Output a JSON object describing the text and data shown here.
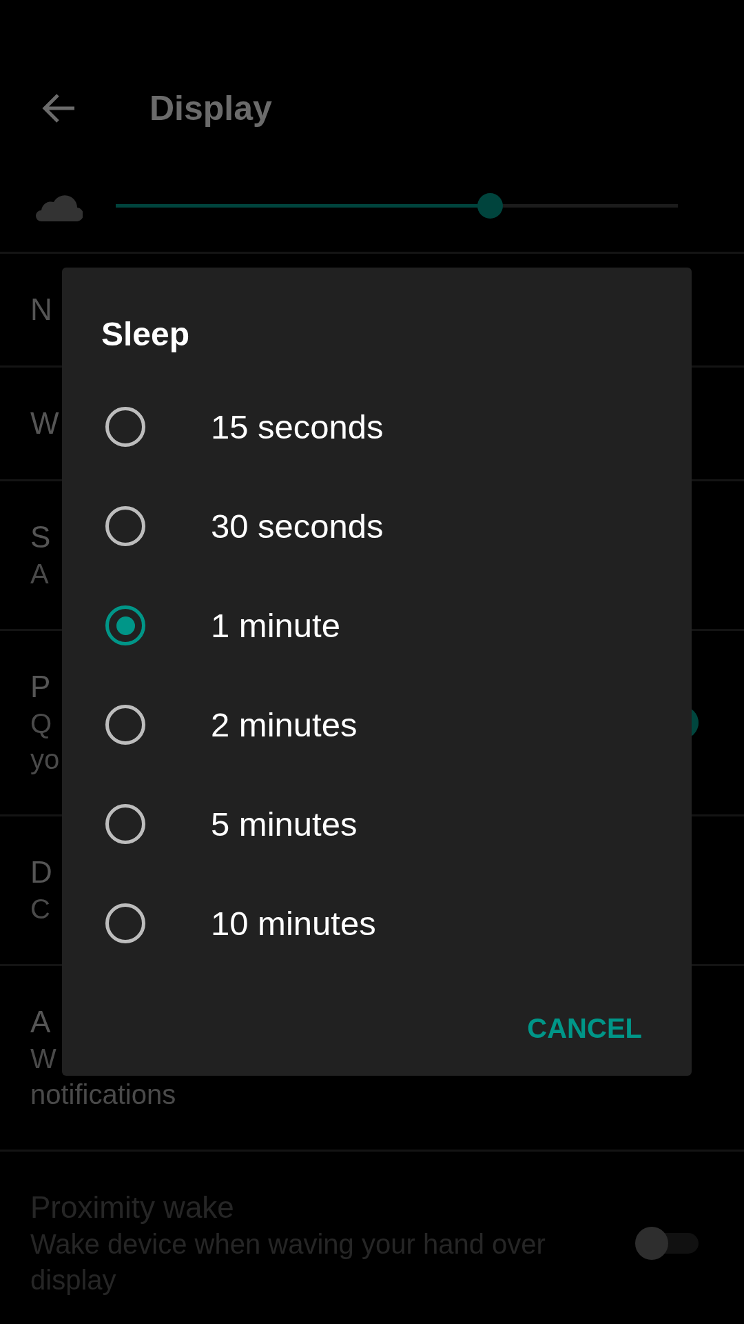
{
  "header": {
    "title": "Display"
  },
  "brightness": {
    "level": 0.665
  },
  "settings": [
    {
      "kind": "text",
      "title": "N"
    },
    {
      "kind": "text",
      "title": "W"
    },
    {
      "kind": "text",
      "title": "S",
      "summary": [
        "A"
      ]
    },
    {
      "kind": "switch",
      "title": "P",
      "summary": [
        "Q",
        "yo"
      ],
      "on": true,
      "disabled": false
    },
    {
      "kind": "text",
      "title": "D",
      "summary": [
        "C"
      ]
    },
    {
      "kind": "text",
      "title": "A",
      "summary": [
        "W",
        "notifications"
      ]
    },
    {
      "kind": "switch",
      "title": "Proximity wake",
      "summary": [
        "Wake device when waving your hand over",
        "display"
      ],
      "on": false,
      "disabled": true
    }
  ],
  "dialog": {
    "title": "Sleep",
    "options": [
      {
        "label": "15 seconds",
        "selected": false
      },
      {
        "label": "30 seconds",
        "selected": false
      },
      {
        "label": "1 minute",
        "selected": true
      },
      {
        "label": "2 minutes",
        "selected": false
      },
      {
        "label": "5 minutes",
        "selected": false
      },
      {
        "label": "10 minutes",
        "selected": false
      }
    ],
    "buttons": [
      "CANCEL"
    ]
  }
}
